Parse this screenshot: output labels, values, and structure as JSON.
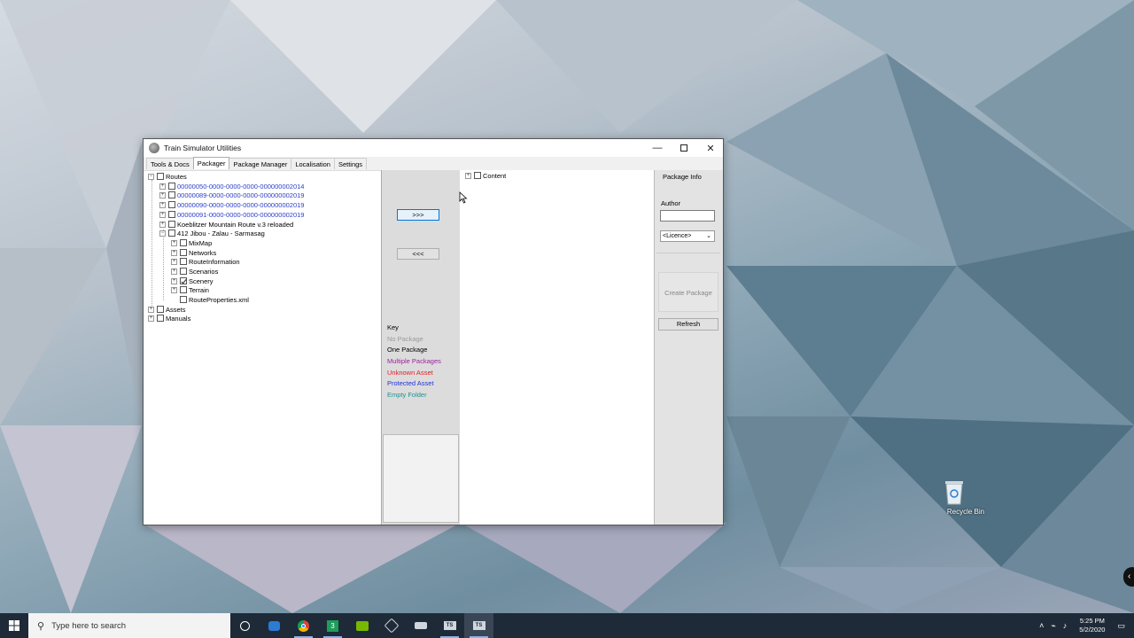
{
  "window": {
    "title": "Train Simulator Utilities"
  },
  "tabs": [
    {
      "label": "Tools & Docs"
    },
    {
      "label": "Packager"
    },
    {
      "label": "Package Manager"
    },
    {
      "label": "Localisation"
    },
    {
      "label": "Settings"
    }
  ],
  "tree": {
    "routes": "Routes",
    "route_items": [
      "00000050-0000-0000-0000-000000002014",
      "00000089-0000-0000-0000-000000002019",
      "00000090-0000-0000-0000-000000002019",
      "00000091-0000-0000-0000-000000002019",
      "Koeblitzer Mountain Route v.3 reloaded",
      "412 Jibou - Zalau - Sarmasag"
    ],
    "sub_items": [
      "MixMap",
      "Networks",
      "RouteInformation",
      "Scenarios",
      "Scenery",
      "Terrain",
      "RouteProperties.xml"
    ],
    "assets": "Assets",
    "manuals": "Manuals"
  },
  "middle": {
    "add_label": ">>>",
    "remove_label": "<<<",
    "key_title": "Key",
    "key_items": [
      {
        "label": "No Package",
        "color": "#9a9a9a"
      },
      {
        "label": "One Package",
        "color": "#000000"
      },
      {
        "label": "Multiple Packages",
        "color": "#a020a0"
      },
      {
        "label": "Unknown Asset",
        "color": "#e0202a"
      },
      {
        "label": "Protected Asset",
        "color": "#2030e0"
      },
      {
        "label": "Empty Folder",
        "color": "#209090"
      }
    ]
  },
  "right_tree": {
    "content": "Content"
  },
  "package_info": {
    "title": "Package Info",
    "author_label": "Author",
    "author_value": "",
    "licence_value": "<Licence>",
    "create_label": "Create Package",
    "refresh_label": "Refresh"
  },
  "desktop": {
    "recycle_bin": "Recycle Bin"
  },
  "taskbar": {
    "search_placeholder": "Type here to search",
    "time": "5:25 PM",
    "date": "5/2/2020"
  }
}
